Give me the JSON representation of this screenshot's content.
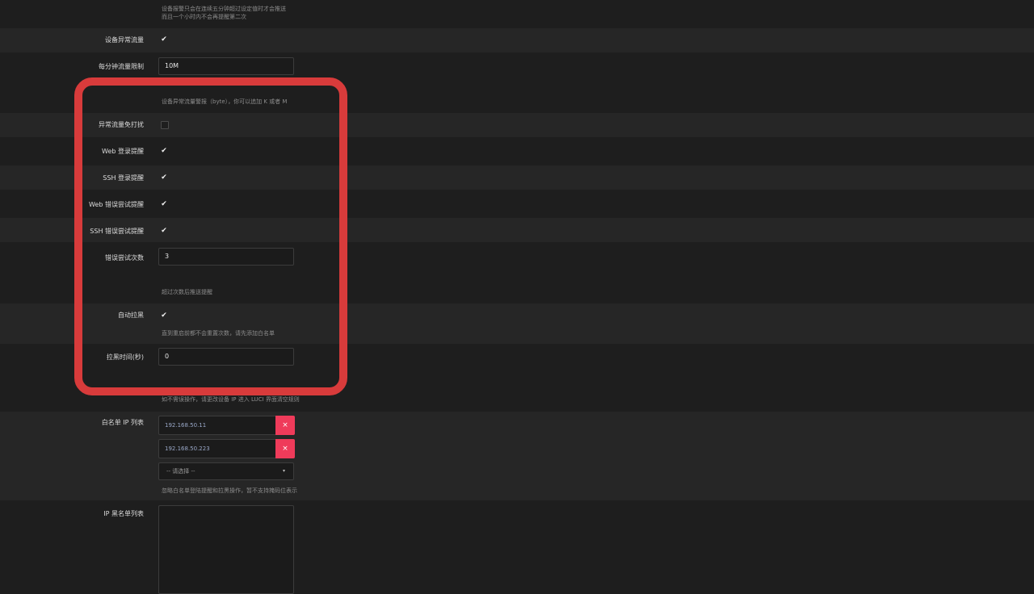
{
  "top_hint_line1": "设备报警只会在连续五分钟超过设定值时才会推送",
  "top_hint_line2": "而且一个小时内不会再提醒第二次",
  "abnormal_traffic": {
    "label": "设备异常流量",
    "checked": true
  },
  "traffic_limit": {
    "label": "每分钟流量限制",
    "value": "10M",
    "hint": "设备异常流量警报（byte），你可以追加 K 或者 M"
  },
  "traffic_dnd": {
    "label": "异常流量免打扰",
    "checked": false
  },
  "web_login": {
    "label": "Web 登录提醒",
    "checked": true
  },
  "ssh_login": {
    "label": "SSH 登录提醒",
    "checked": true
  },
  "web_failed": {
    "label": "Web 错误尝试提醒",
    "checked": true
  },
  "ssh_failed": {
    "label": "SSH 错误尝试提醒",
    "checked": true
  },
  "attempt_count": {
    "label": "错误尝试次数",
    "value": "3",
    "hint": "超过次数后推送提醒"
  },
  "auto_block": {
    "label": "自动拉黑",
    "checked": true,
    "hint": "直到重启前都不会重置次数，请先添加白名单"
  },
  "block_time": {
    "label": "拉黑时间(秒)",
    "value": "0",
    "hint": "如不需误操作，请更改设备 IP 进入 LUCI 界面清空规则"
  },
  "whitelist": {
    "label": "白名单 IP 列表",
    "items": [
      "192.168.50.11",
      "192.168.50.223"
    ],
    "remove_icon": "close-icon",
    "remove_glyph": "×",
    "select_placeholder": "-- 请选择 --",
    "select_arrow": "▾",
    "hint": "忽略白名单登陆提醒和拉黑操作，暂不支持掩码位表示"
  },
  "blacklist": {
    "label": "IP 黑名单列表"
  },
  "check_glyph": "✔",
  "colors": {
    "highlight": "#d83b3b",
    "remove_button": "#ef3b5a",
    "background": "#1e1e1e",
    "row_alt": "#262626"
  }
}
